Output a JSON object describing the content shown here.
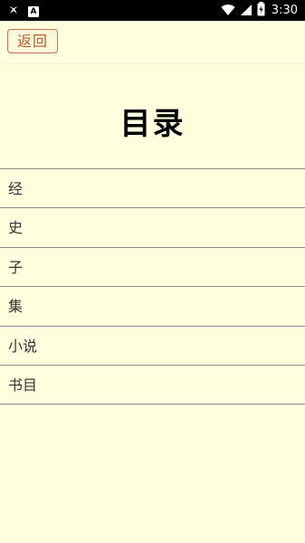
{
  "status_bar": {
    "time": "3:30",
    "icons": [
      "bug-icon",
      "app-a-icon",
      "wifi-icon",
      "signal-icon",
      "battery-charging-icon"
    ]
  },
  "header": {
    "back_label": "返回"
  },
  "page": {
    "title": "目录"
  },
  "menu": {
    "items": [
      {
        "label": "经"
      },
      {
        "label": "史"
      },
      {
        "label": "子"
      },
      {
        "label": "集"
      },
      {
        "label": "小说"
      },
      {
        "label": "书目"
      }
    ]
  },
  "colors": {
    "background": "#ffffde",
    "status_bar": "#000000",
    "back_button_border": "#c0764a",
    "back_button_text": "#b85e2c",
    "divider": "#8a8a8a"
  }
}
